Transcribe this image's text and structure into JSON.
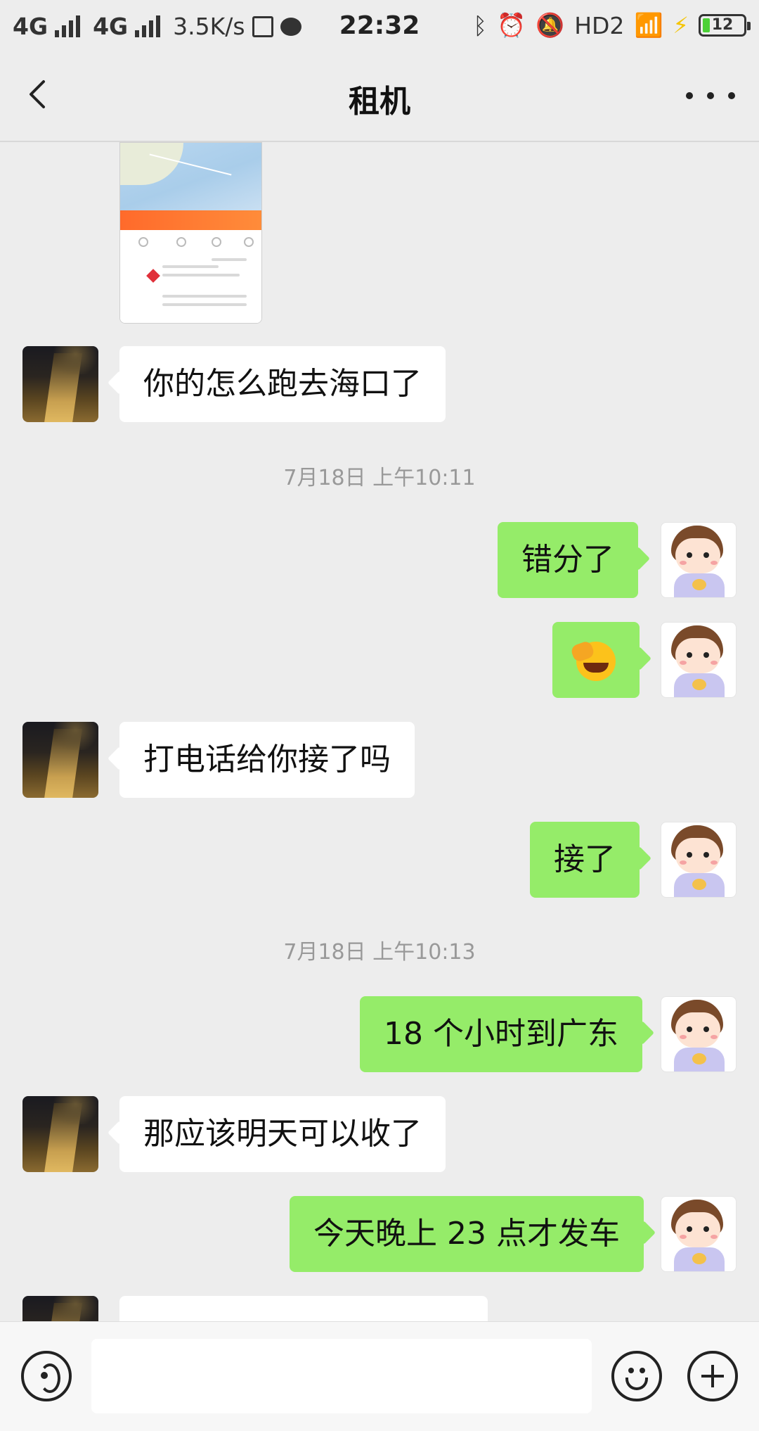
{
  "status_bar": {
    "network1": "4G",
    "network2": "4G",
    "speed": "3.5K/s",
    "time": "22:32",
    "hd": "HD2",
    "battery": "12"
  },
  "header": {
    "title": "租机"
  },
  "messages": [
    {
      "side": "left",
      "text": "你的怎么跑去海口了"
    },
    {
      "side": "right",
      "text": "错分了"
    },
    {
      "side": "right",
      "emoji": "face-palm-emoji"
    },
    {
      "side": "left",
      "text": "打电话给你接了吗"
    },
    {
      "side": "right",
      "text": "接了"
    },
    {
      "side": "right",
      "text": "18 个小时到广东"
    },
    {
      "side": "left",
      "text": "那应该明天可以收了"
    },
    {
      "side": "right",
      "text": "今天晚上 23 点才发车"
    }
  ],
  "timestamps": [
    "7月18日 上午10:11",
    "7月18日 上午10:13"
  ],
  "input": {
    "placeholder": ""
  },
  "colors": {
    "background": "#ededed",
    "bubble_self": "#95ec69",
    "bubble_other": "#ffffff"
  }
}
